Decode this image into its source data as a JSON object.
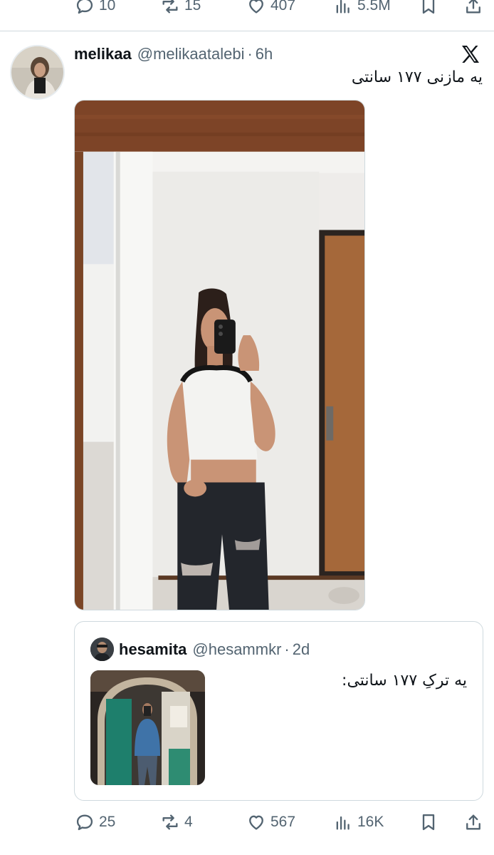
{
  "prev_actions": {
    "replies": "10",
    "reposts": "15",
    "likes": "407",
    "views": "5.5M"
  },
  "tweet": {
    "display_name": "melikaa",
    "handle": "@melikaatalebi",
    "dot": "·",
    "time": "6h",
    "text": "یه مازنی ۱۷۷ سانتی",
    "photo_alt": "mirror selfie photo"
  },
  "quote": {
    "display_name": "hesamita",
    "handle": "@hesammkr",
    "dot": "·",
    "time": "2d",
    "text": "یه ترکِ ۱۷۷ سانتی:"
  },
  "actions": {
    "replies": "25",
    "reposts": "4",
    "likes": "567",
    "views": "16K"
  },
  "icons": [
    "reply-icon",
    "repost-icon",
    "like-icon",
    "views-icon",
    "bookmark-icon",
    "share-icon",
    "x-logo-icon"
  ],
  "colors": {
    "text": "#0f1419",
    "secondary": "#536471",
    "border": "#cfd9de"
  }
}
